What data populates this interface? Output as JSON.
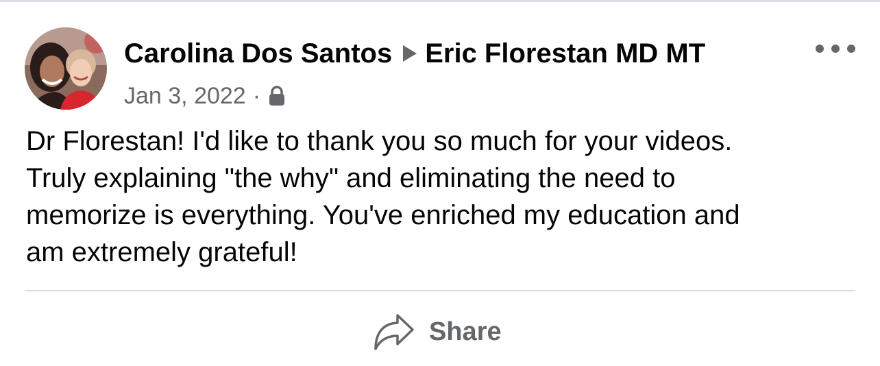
{
  "post": {
    "author_name": "Carolina Dos Santos",
    "recipient_name": "Eric Florestan MD MT",
    "date": "Jan 3, 2022",
    "separator": "·",
    "privacy_icon": "lock-icon",
    "text_lines": [
      "Dr Florestan! I'd like to thank you so much for your videos.",
      "Truly explaining \"the why\" and eliminating the need to",
      "memorize is everything. You've enriched my education and",
      "am extremely grateful!"
    ]
  },
  "actions": {
    "share_label": "Share",
    "share_icon": "share-arrow-icon",
    "more_icon": "more-dots-icon"
  },
  "colors": {
    "primary_text": "#050505",
    "secondary_text": "#65676b",
    "divider": "#dadde1",
    "background": "#ffffff"
  }
}
